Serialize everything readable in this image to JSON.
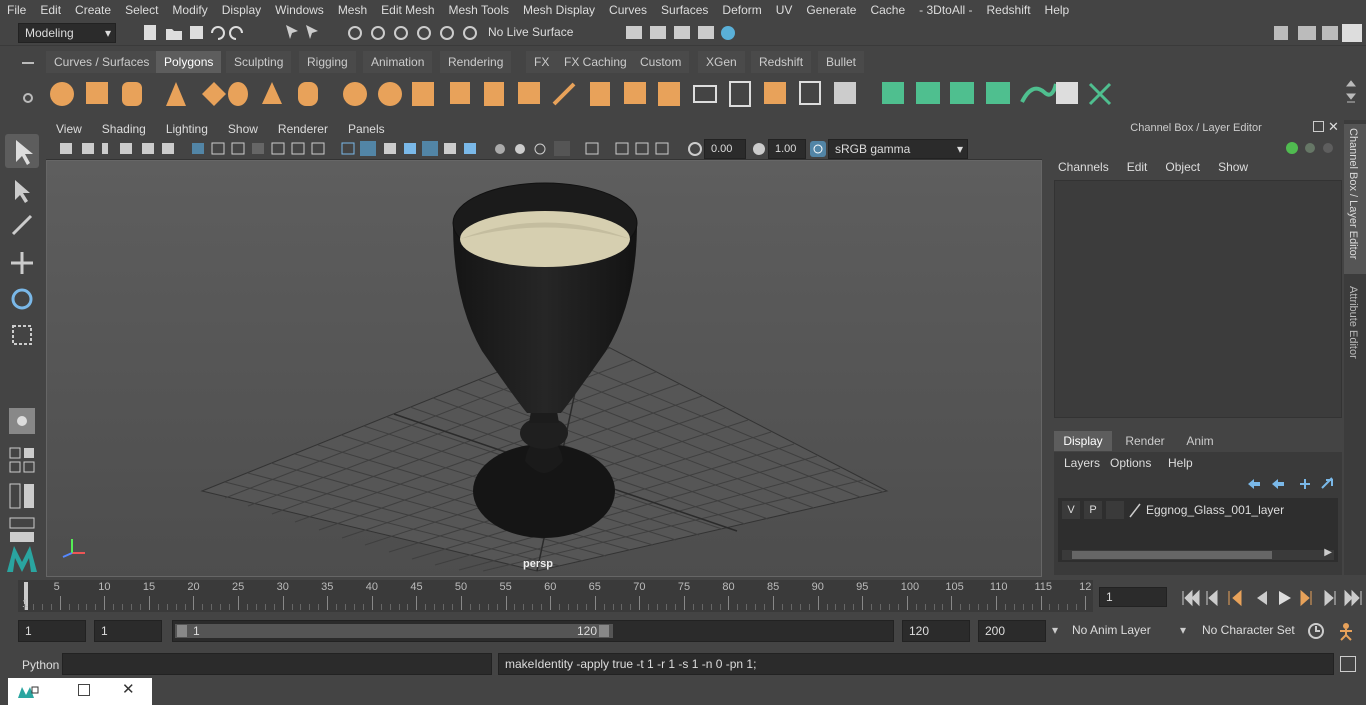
{
  "menubar": [
    "File",
    "Edit",
    "Create",
    "Select",
    "Modify",
    "Display",
    "Windows",
    "Mesh",
    "Edit Mesh",
    "Mesh Tools",
    "Mesh Display",
    "Curves",
    "Surfaces",
    "Deform",
    "UV",
    "Generate",
    "Cache",
    "- 3DtoAll -",
    "Redshift",
    "Help"
  ],
  "status": {
    "mode": "Modeling",
    "live_surface": "No Live Surface"
  },
  "shelf_tabs": [
    "Curves / Surfaces",
    "Polygons",
    "Sculpting",
    "Rigging",
    "Animation",
    "Rendering",
    "FX",
    "FX Caching",
    "Custom",
    "XGen",
    "Redshift",
    "Bullet"
  ],
  "shelf_active": "Polygons",
  "viewport": {
    "menus": [
      "View",
      "Shading",
      "Lighting",
      "Show",
      "Renderer",
      "Panels"
    ],
    "exposure": "0.00",
    "gamma": "1.00",
    "color_space": "sRGB gamma",
    "camera_label": "persp"
  },
  "channel_box": {
    "title": "Channel Box / Layer Editor",
    "menus": [
      "Channels",
      "Edit",
      "Object",
      "Show"
    ]
  },
  "layer_editor": {
    "tabs": [
      "Display",
      "Render",
      "Anim"
    ],
    "active_tab": "Display",
    "menus": [
      "Layers",
      "Options",
      "Help"
    ],
    "layer": {
      "v": "V",
      "p": "P",
      "name": "Eggnog_Glass_001_layer"
    }
  },
  "side_tabs": [
    "Channel Box / Layer Editor",
    "Attribute Editor"
  ],
  "timeline": {
    "ticks": [
      "5",
      "10",
      "15",
      "20",
      "25",
      "30",
      "35",
      "40",
      "45",
      "50",
      "55",
      "60",
      "65",
      "70",
      "75",
      "80",
      "85",
      "90",
      "95",
      "100",
      "105",
      "110",
      "115",
      "12"
    ],
    "start_label": "1",
    "current_frame": "1"
  },
  "range": {
    "start": "1",
    "anim_start": "1",
    "slider_start": "1",
    "slider_end": "120",
    "end": "120",
    "anim_end": "200",
    "anim_layer": "No Anim Layer",
    "character_set": "No Character Set"
  },
  "cmdline": {
    "lang": "Python",
    "output": "makeIdentity -apply true -t 1 -r 1 -s 1 -n 0 -pn 1;"
  },
  "colors": {
    "accent_blue": "#5285a6",
    "shelf_orange": "#e8a25a",
    "shelf_green": "#4fbf8f",
    "viewport_bg": "#5a5a5a"
  }
}
